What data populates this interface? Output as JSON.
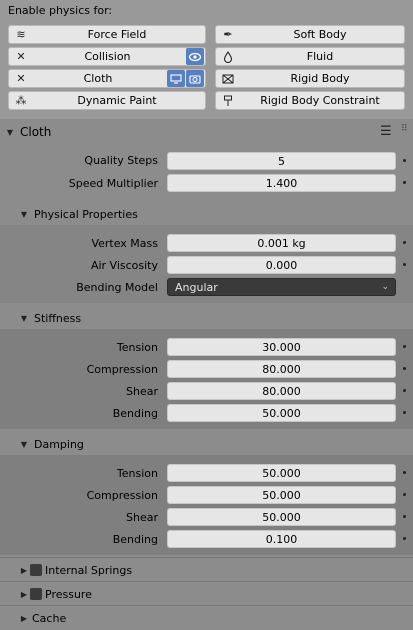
{
  "header": {
    "title": "Enable physics for:"
  },
  "physics_buttons": {
    "force_field": "Force Field",
    "soft_body": "Soft Body",
    "collision": "Collision",
    "fluid": "Fluid",
    "cloth": "Cloth",
    "rigid_body": "Rigid Body",
    "dynamic_paint": "Dynamic Paint",
    "rigid_body_constraint": "Rigid Body Constraint"
  },
  "cloth": {
    "title": "Cloth",
    "quality_steps_label": "Quality Steps",
    "quality_steps": "5",
    "speed_multiplier_label": "Speed Multiplier",
    "speed_multiplier": "1.400"
  },
  "physical": {
    "title": "Physical Properties",
    "vertex_mass_label": "Vertex Mass",
    "vertex_mass": "0.001 kg",
    "air_viscosity_label": "Air Viscosity",
    "air_viscosity": "0.000",
    "bending_model_label": "Bending Model",
    "bending_model": "Angular"
  },
  "stiffness": {
    "title": "Stiffness",
    "tension_label": "Tension",
    "tension": "30.000",
    "compression_label": "Compression",
    "compression": "80.000",
    "shear_label": "Shear",
    "shear": "80.000",
    "bending_label": "Bending",
    "bending": "50.000"
  },
  "damping": {
    "title": "Damping",
    "tension_label": "Tension",
    "tension": "50.000",
    "compression_label": "Compression",
    "compression": "50.000",
    "shear_label": "Shear",
    "shear": "50.000",
    "bending_label": "Bending",
    "bending": "0.100"
  },
  "collapsed": {
    "internal_springs": "Internal Springs",
    "pressure": "Pressure",
    "cache": "Cache"
  },
  "colors": {
    "accent": "#5680c2",
    "panel": "#8c8c8c",
    "subpanel": "#7f7f7f"
  }
}
